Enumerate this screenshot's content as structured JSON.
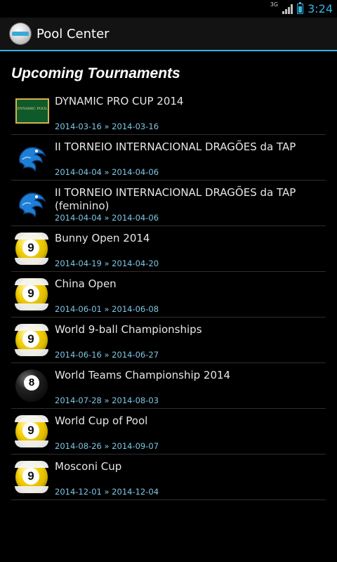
{
  "status_bar": {
    "network": "3G",
    "clock": "3:24",
    "signal_icon": "signal-bars",
    "battery_icon": "battery-charging"
  },
  "action_bar": {
    "title": "Pool Center",
    "icon": "pool-ball-logo"
  },
  "section_title": "Upcoming Tournaments",
  "colors": {
    "accent": "#33b5e5",
    "date_text": "#7cc7e6",
    "background": "#000000"
  },
  "tournaments": [
    {
      "title": "DYNAMIC PRO CUP 2014",
      "dates": "2014-03-16 » 2014-03-16",
      "thumb": "dynamic-logo",
      "logo_text": "DYNAMIC POOL"
    },
    {
      "title": "II TORNEIO INTERNACIONAL DRAGÕES da TAP",
      "dates": "2014-04-04 » 2014-04-06",
      "thumb": "dragon-logo"
    },
    {
      "title": "II TORNEIO INTERNACIONAL DRAGÕES da TAP (feminino)",
      "dates": "2014-04-04 » 2014-04-06",
      "thumb": "dragon-logo"
    },
    {
      "title": "Bunny Open 2014",
      "dates": "2014-04-19 » 2014-04-20",
      "thumb": "nine-ball",
      "ball_number": "9"
    },
    {
      "title": "China Open",
      "dates": "2014-06-01 » 2014-06-08",
      "thumb": "nine-ball",
      "ball_number": "9"
    },
    {
      "title": "World 9-ball Championships",
      "dates": "2014-06-16 » 2014-06-27",
      "thumb": "nine-ball",
      "ball_number": "9"
    },
    {
      "title": "World Teams Championship 2014",
      "dates": "2014-07-28 » 2014-08-03",
      "thumb": "eight-ball",
      "ball_number": "8"
    },
    {
      "title": "World Cup of Pool",
      "dates": "2014-08-26 » 2014-09-07",
      "thumb": "nine-ball",
      "ball_number": "9"
    },
    {
      "title": "Mosconi Cup",
      "dates": "2014-12-01 » 2014-12-04",
      "thumb": "nine-ball",
      "ball_number": "9"
    }
  ]
}
